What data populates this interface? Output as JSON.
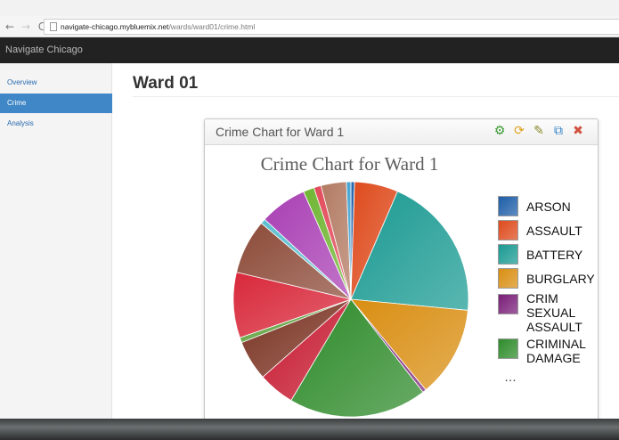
{
  "browser": {
    "back_icon": "back-arrow-icon",
    "forward_icon": "forward-arrow-icon",
    "reload_icon": "reload-icon",
    "url_host": "navigate-chicago.mybluemix.net",
    "url_path": "/wards/ward01/crime.html"
  },
  "app": {
    "brand": "Navigate Chicago"
  },
  "sidebar": {
    "items": [
      {
        "label": "Overview",
        "active": false
      },
      {
        "label": "Crime",
        "active": true
      },
      {
        "label": "Analysis",
        "active": false
      }
    ]
  },
  "main": {
    "title": "Ward 01"
  },
  "widget": {
    "title": "Crime Chart for Ward 1",
    "controls": [
      {
        "icon": "gear-icon",
        "color": "#3a9a32"
      },
      {
        "icon": "refresh-icon",
        "color": "#e2a11c"
      },
      {
        "icon": "edit-icon",
        "color": "#8a8a30"
      },
      {
        "icon": "external-link-icon",
        "color": "#2f7fc4"
      },
      {
        "icon": "close-icon",
        "color": "#d0523f"
      }
    ]
  },
  "chart_data": {
    "type": "pie",
    "title": "Crime Chart for Ward 1",
    "legend_position": "right",
    "legend_more": "…",
    "series": [
      {
        "name": "ARSON",
        "value": 0.5,
        "color": "#1e5ea8"
      },
      {
        "name": "ASSAULT",
        "value": 6.0,
        "color": "#de4a1c"
      },
      {
        "name": "BATTERY",
        "value": 20.0,
        "color": "#1a9a92"
      },
      {
        "name": "BURGLARY",
        "value": 12.5,
        "color": "#d98e12"
      },
      {
        "name": "CRIM SEXUAL ASSAULT",
        "value": 0.5,
        "color": "#7a1f78"
      },
      {
        "name": "CRIMINAL DAMAGE",
        "value": 19.0,
        "color": "#2e8b2a"
      },
      {
        "name": "",
        "value": 5.0,
        "color": "#c6182f"
      },
      {
        "name": "",
        "value": 5.5,
        "color": "#7a3322"
      },
      {
        "name": "",
        "value": 0.7,
        "color": "#5aa03a"
      },
      {
        "name": "",
        "value": 9.0,
        "color": "#d8283a"
      },
      {
        "name": "",
        "value": 7.5,
        "color": "#8c4a38"
      },
      {
        "name": "",
        "value": 0.7,
        "color": "#5cc0d0"
      },
      {
        "name": "",
        "value": 6.5,
        "color": "#a93fb4"
      },
      {
        "name": "",
        "value": 1.5,
        "color": "#6fb532"
      },
      {
        "name": "",
        "value": 1.0,
        "color": "#e24a5a"
      },
      {
        "name": "",
        "value": 3.5,
        "color": "#b27a62"
      },
      {
        "name": "",
        "value": 0.6,
        "color": "#3aa0d0"
      }
    ]
  }
}
